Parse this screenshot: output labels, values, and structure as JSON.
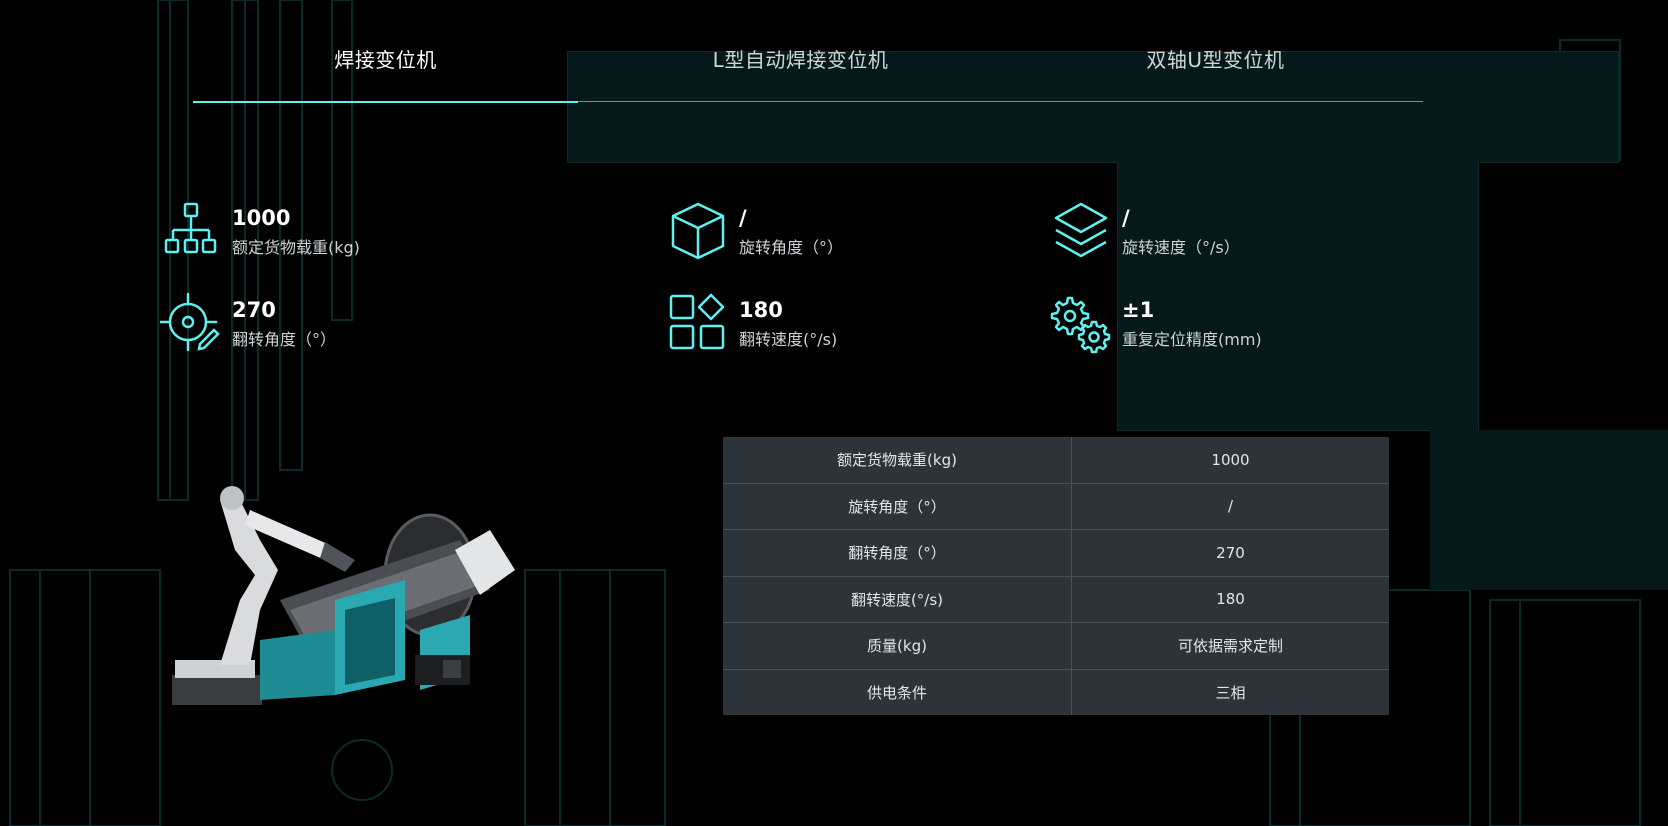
{
  "tabs": [
    {
      "label": "焊接变位机",
      "active": true
    },
    {
      "label": "L型自动焊接变位机",
      "active": false
    },
    {
      "label": "双轴U型变位机",
      "active": false
    }
  ],
  "specs": [
    {
      "value": "1000",
      "label": "额定货物载重(kg)",
      "icon": "hierarchy-icon"
    },
    {
      "value": "/",
      "label": "旋转角度（°）",
      "icon": "cube-icon"
    },
    {
      "value": "/",
      "label": "旋转速度（°/s）",
      "icon": "layers-icon"
    },
    {
      "value": "270",
      "label": "翻转角度（°）",
      "icon": "target-edit-icon"
    },
    {
      "value": "180",
      "label": "翻转速度(°/s)",
      "icon": "grid-shapes-icon"
    },
    {
      "value": "±1",
      "label": "重复定位精度(mm)",
      "icon": "gears-icon"
    }
  ],
  "table": [
    {
      "key": "额定货物载重(kg)",
      "value": "1000"
    },
    {
      "key": "旋转角度（°）",
      "value": "/"
    },
    {
      "key": "翻转角度（°）",
      "value": "270"
    },
    {
      "key": "翻转速度(°/s)",
      "value": "180"
    },
    {
      "key": "质量(kg)",
      "value": "可依据需求定制"
    },
    {
      "key": "供电条件",
      "value": "三相"
    }
  ],
  "colors": {
    "accent": "#5ff0f0",
    "background": "#000000",
    "table_bg": "#2d3439"
  }
}
